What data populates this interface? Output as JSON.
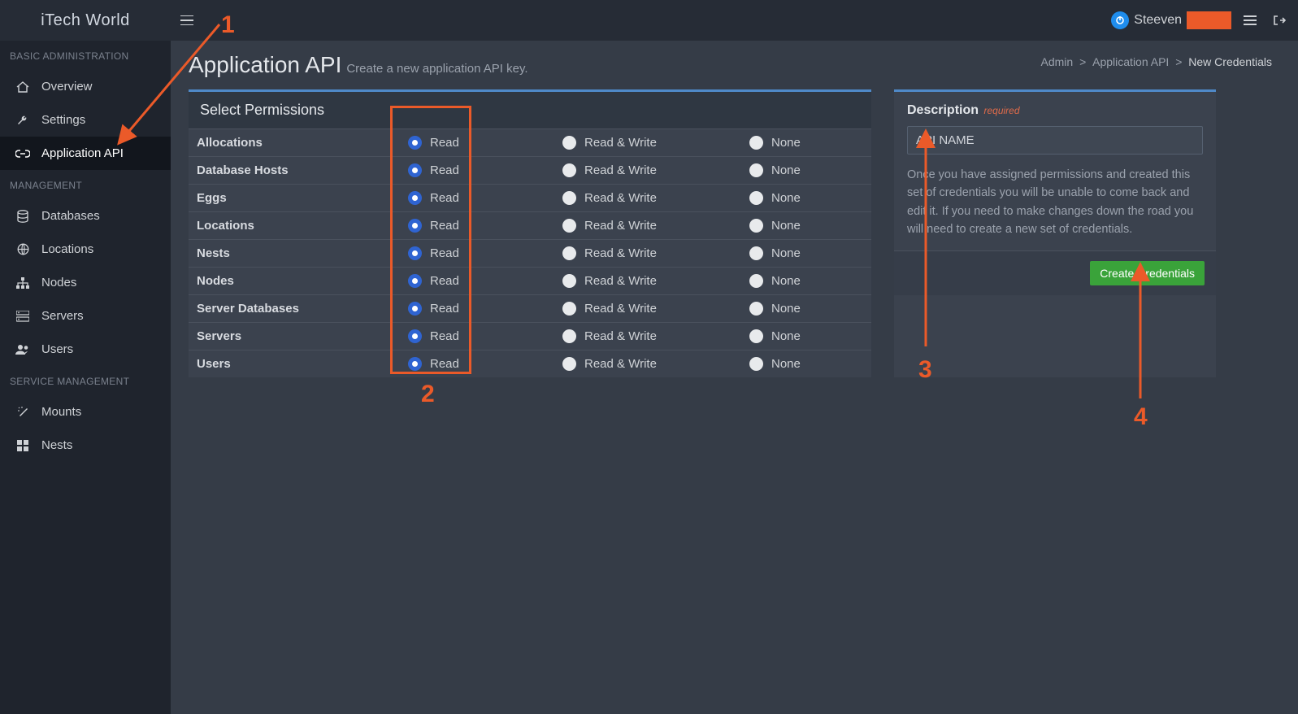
{
  "brand": "iTech World",
  "user": {
    "name": "Steeven"
  },
  "page": {
    "title": "Application API",
    "subtitle": "Create a new application API key."
  },
  "breadcrumb": {
    "a": "Admin",
    "b": "Application API",
    "c": "New Credentials",
    "sep": ">"
  },
  "sidebar": {
    "sections": {
      "basic": "BASIC ADMINISTRATION",
      "mgmt": "MANAGEMENT",
      "svc": "SERVICE MANAGEMENT"
    },
    "items": {
      "overview": "Overview",
      "settings": "Settings",
      "appapi": "Application API",
      "databases": "Databases",
      "locations": "Locations",
      "nodes": "Nodes",
      "servers": "Servers",
      "users": "Users",
      "mounts": "Mounts",
      "nests": "Nests"
    }
  },
  "perm": {
    "header": "Select Permissions",
    "cols": {
      "read": "Read",
      "rw": "Read & Write",
      "none": "None"
    },
    "rows": [
      {
        "name": "Allocations"
      },
      {
        "name": "Database Hosts"
      },
      {
        "name": "Eggs"
      },
      {
        "name": "Locations"
      },
      {
        "name": "Nests"
      },
      {
        "name": "Nodes"
      },
      {
        "name": "Server Databases"
      },
      {
        "name": "Servers"
      },
      {
        "name": "Users"
      }
    ]
  },
  "desc": {
    "label": "Description",
    "required": "required",
    "value": "API NAME",
    "help": "Once you have assigned permissions and created this set of credentials you will be unable to come back and edit it. If you need to make changes down the road you will need to create a new set of credentials."
  },
  "buttons": {
    "create": "Create Credentials"
  },
  "annotations": {
    "n1": "1",
    "n2": "2",
    "n3": "3",
    "n4": "4"
  }
}
